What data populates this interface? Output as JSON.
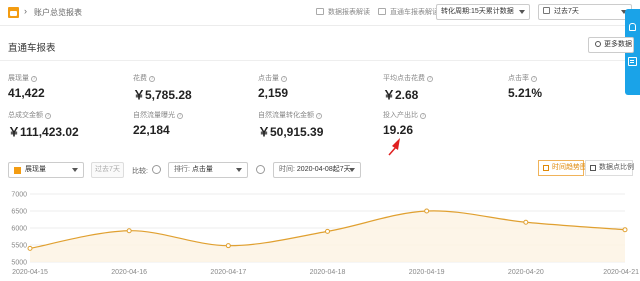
{
  "breadcrumb": {
    "current": "账户总览报表"
  },
  "toolbar": {
    "report_guide": "数据报表解读",
    "zhitongche_guide": "直通车报表解读",
    "conversion_period": "转化周期:15天累计数据",
    "date_range": "过去7天"
  },
  "section": {
    "title": "直通车报表",
    "more_data": "更多数据"
  },
  "metrics": [
    {
      "label": "展现量",
      "value": "41,422"
    },
    {
      "label": "花费",
      "value": "￥5,785.28"
    },
    {
      "label": "点击量",
      "value": "2,159"
    },
    {
      "label": "平均点击花费",
      "value": "￥2.68"
    },
    {
      "label": "点击率",
      "value": "5.21%"
    },
    {
      "label": "总成交金额",
      "value": "￥111,423.02"
    },
    {
      "label": "自然流量曝光",
      "value": "22,184"
    },
    {
      "label": "自然流量转化金额",
      "value": "￥50,915.39"
    },
    {
      "label": "投入产出比",
      "value": "19.26"
    }
  ],
  "controls": {
    "metric_select": "展现量",
    "period": "过去7天",
    "compare_label": "比较:",
    "sort_label": "排行:",
    "sort_value": "点击量",
    "time_label": "时间:",
    "time_value": "2020-04-08起7天",
    "trend_view": "时间趋势图",
    "compare_view": "数据点比例"
  },
  "colors": {
    "accent": "#f39c12",
    "line": "#e0a030",
    "arrow": "#e02020",
    "side_tab": "#1aa3e8"
  },
  "icons": {
    "home": "home-icon",
    "guide": "book-icon",
    "calendar": "calendar-icon",
    "settings": "gear-icon",
    "bell": "bell-icon",
    "message": "message-icon"
  },
  "chart_data": {
    "type": "line",
    "categories": [
      "2020-04-15",
      "2020-04-16",
      "2020-04-17",
      "2020-04-18",
      "2020-04-19",
      "2020-04-20",
      "2020-04-21"
    ],
    "series": [
      {
        "values": [
          5400,
          5920,
          5480,
          5900,
          6500,
          6170,
          5950
        ]
      }
    ],
    "yticks": [
      5000,
      5500,
      6000,
      6500,
      7000
    ],
    "ylim": [
      5000,
      7000
    ],
    "grid": true,
    "legend": "none"
  }
}
